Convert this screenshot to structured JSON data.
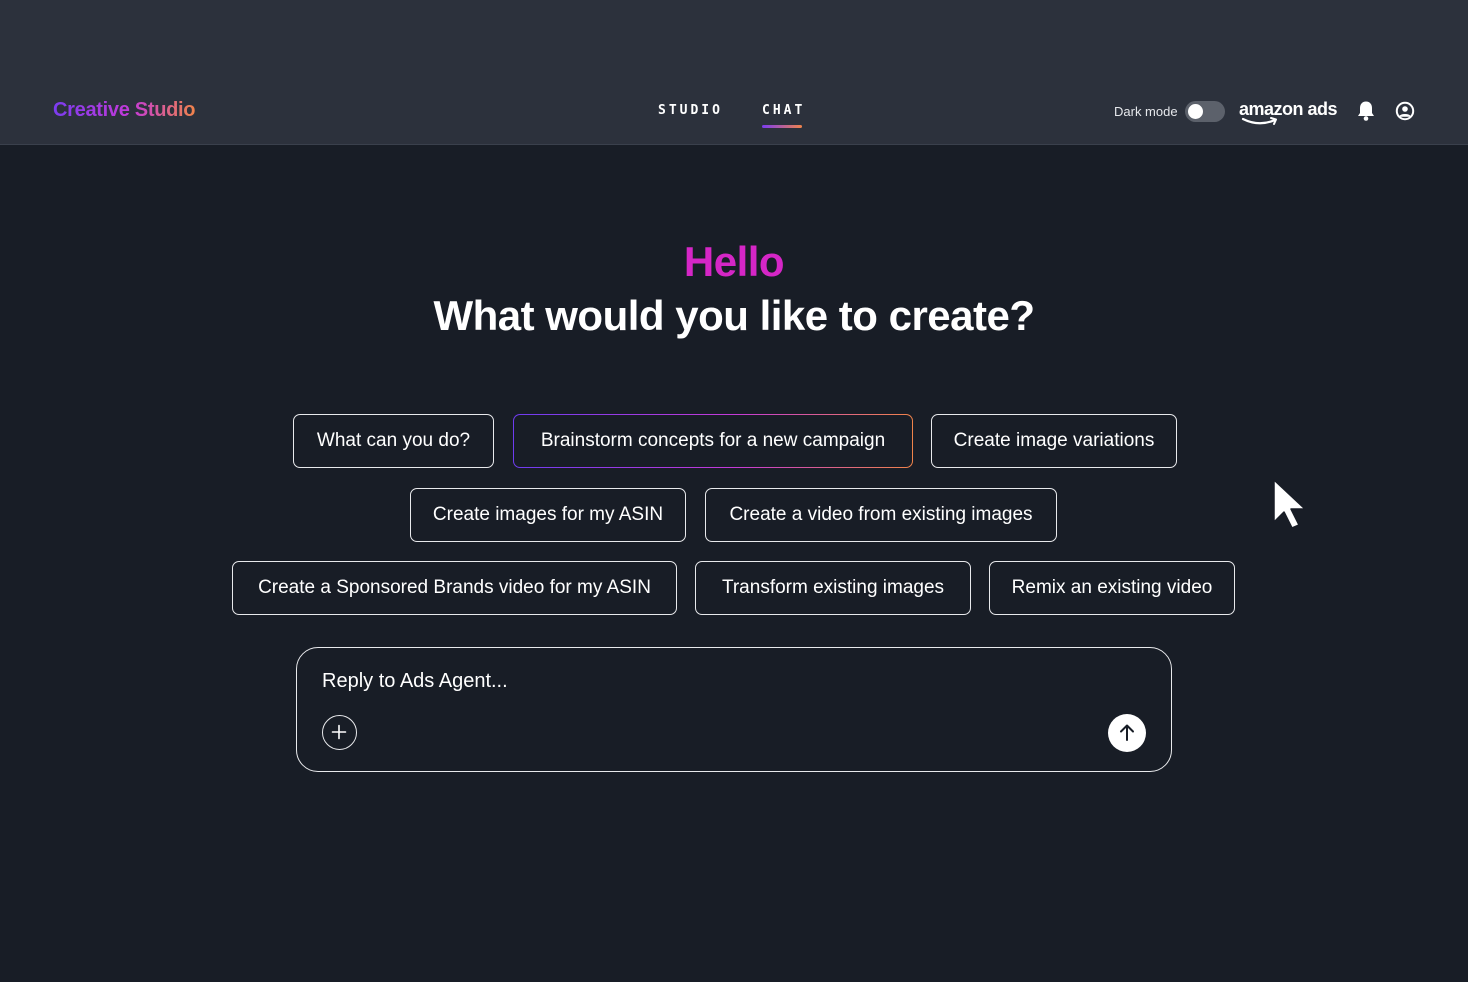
{
  "header": {
    "brand": "Creative Studio",
    "tabs": [
      {
        "label": "STUDIO",
        "active": false
      },
      {
        "label": "CHAT",
        "active": true
      }
    ],
    "dark_mode_label": "Dark mode",
    "dark_mode_on": false,
    "partner_logo": "amazon ads",
    "icons": [
      "bell-icon",
      "user-account-icon"
    ]
  },
  "hero": {
    "greeting": "Hello",
    "question": "What would you like to create?"
  },
  "suggestions": [
    {
      "label": "What can you do?"
    },
    {
      "label": "Brainstorm concepts for a new campaign",
      "highlighted": true
    },
    {
      "label": "Create image variations"
    },
    {
      "label": "Create images for my ASIN"
    },
    {
      "label": "Create a video from existing images"
    },
    {
      "label": "Create a Sponsored Brands video for my ASIN"
    },
    {
      "label": "Transform existing images"
    },
    {
      "label": "Remix an existing video"
    }
  ],
  "composer": {
    "placeholder": "Reply to Ads Agent...",
    "icons": [
      "plus-icon",
      "arrow-up-icon"
    ]
  },
  "colors": {
    "background": "#181d26",
    "header_bg": "#2c313c",
    "greeting": "#d526c6",
    "gradient_start": "#6e3cf0",
    "gradient_end": "#f0834a"
  }
}
